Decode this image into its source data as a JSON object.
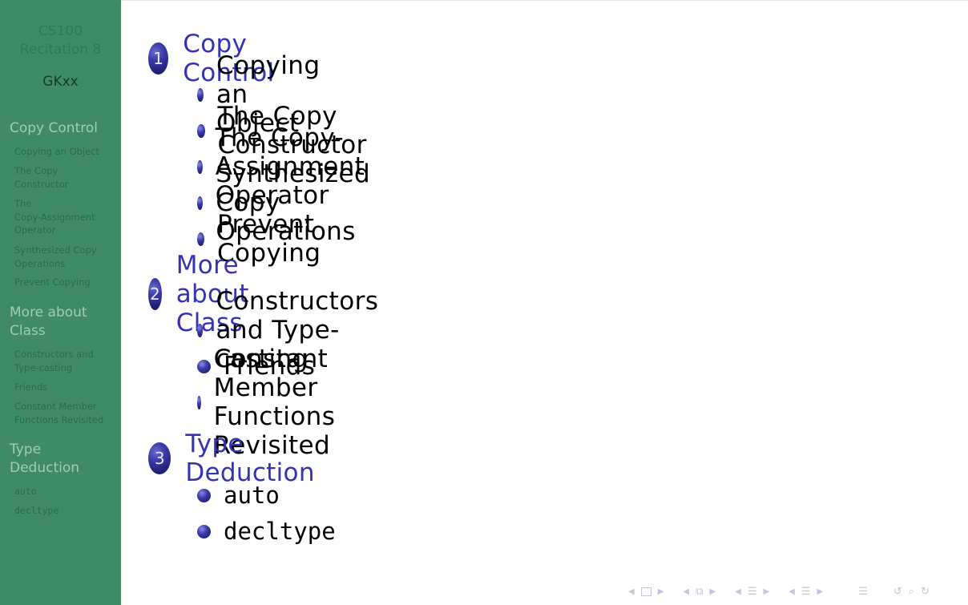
{
  "sidebar": {
    "title_line1": "CS100",
    "title_line2": "Recitation 8",
    "author": "GKxx",
    "sections": [
      {
        "title_lines": [
          "Copy Control"
        ],
        "subsections": [
          {
            "lines": [
              "Copying an Object"
            ]
          },
          {
            "lines": [
              "The Copy",
              "Constructor"
            ]
          },
          {
            "lines": [
              "The",
              "Copy-Assignment",
              "Operator"
            ]
          },
          {
            "lines": [
              "Synthesized Copy",
              "Operations"
            ]
          },
          {
            "lines": [
              "Prevent Copying"
            ]
          }
        ]
      },
      {
        "title_lines": [
          "More about",
          "Class"
        ],
        "subsections": [
          {
            "lines": [
              "Constructors and",
              "Type-casting"
            ]
          },
          {
            "lines": [
              "Friends"
            ]
          },
          {
            "lines": [
              "Constant Member",
              "Functions Revisited"
            ]
          }
        ]
      },
      {
        "title_lines": [
          "Type",
          "Deduction"
        ],
        "subsections": [
          {
            "lines": [
              "auto"
            ]
          },
          {
            "lines": [
              "decltype"
            ]
          }
        ]
      }
    ]
  },
  "toc": {
    "sections": [
      {
        "number": "1",
        "title": "Copy Control",
        "items": [
          "Copying an Object",
          "The Copy Constructor",
          "The Copy-Assignment Operator",
          "Synthesized Copy Operations",
          "Prevent Copying"
        ]
      },
      {
        "number": "2",
        "title": "More about Class",
        "items": [
          "Constructors and Type-casting",
          "Friends",
          "Constant Member Functions Revisited"
        ]
      },
      {
        "number": "3",
        "title": "Type Deduction",
        "items": [
          "auto",
          "decltype"
        ]
      }
    ]
  },
  "navigation": {
    "icons": [
      "prev-frame-arrow",
      "frame-icon",
      "next-frame-arrow",
      "prev-subsection-arrow",
      "subsection-icon",
      "next-subsection-arrow",
      "prev-section-arrow",
      "section-icon",
      "next-section-arrow",
      "prev-part-arrow",
      "part-icon",
      "next-part-arrow",
      "document-icon",
      "back-icon",
      "search-icon",
      "forward-icon"
    ]
  },
  "colors": {
    "sidebar_bg": "#3f8b66",
    "section_title": "#3333b3",
    "sidebar_section": "#9ccfb2",
    "sidebar_subsection": "#2a6a49"
  }
}
